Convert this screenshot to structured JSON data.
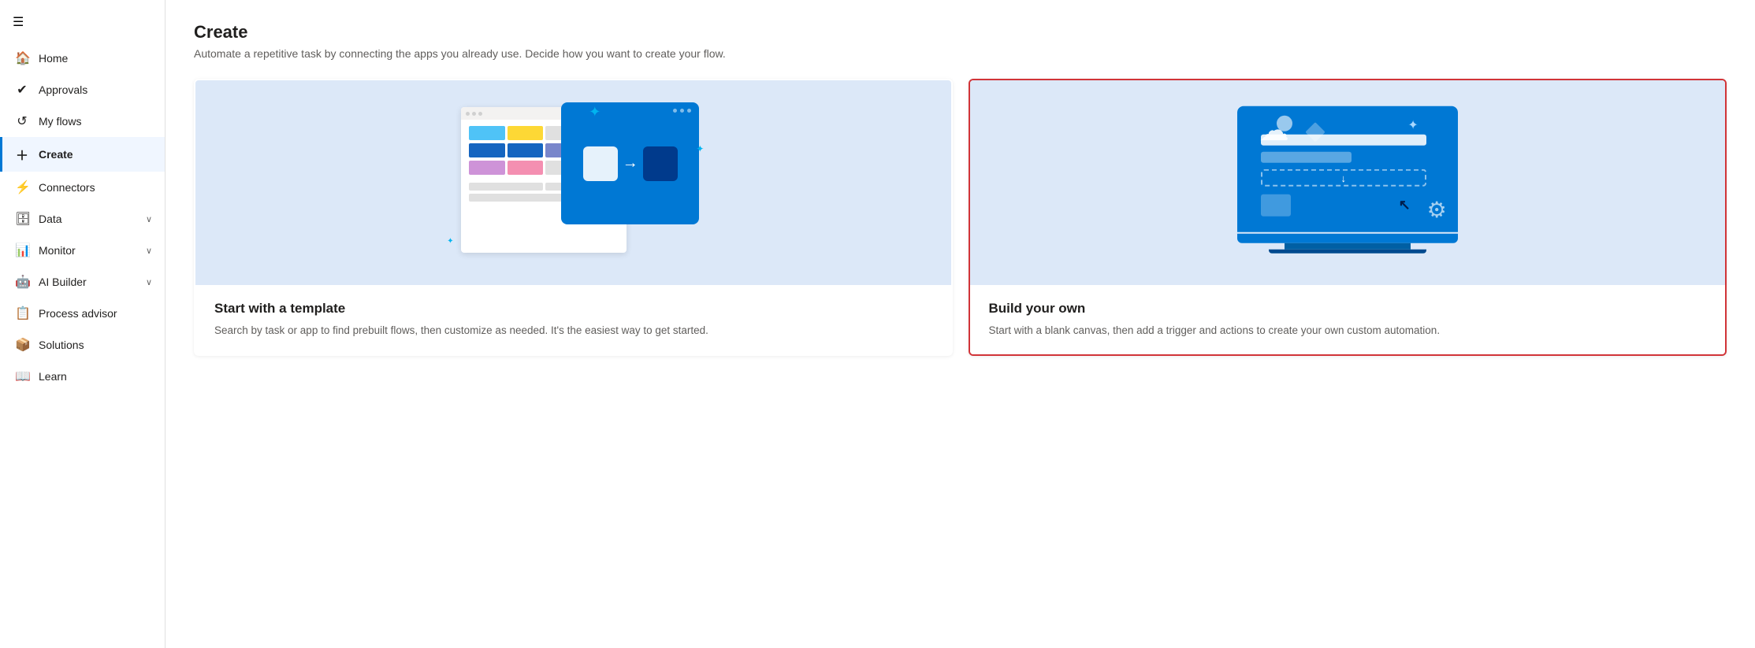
{
  "sidebar": {
    "hamburger_icon": "☰",
    "items": [
      {
        "id": "home",
        "label": "Home",
        "icon": "🏠",
        "hasChevron": false,
        "active": false
      },
      {
        "id": "approvals",
        "label": "Approvals",
        "icon": "✓",
        "hasChevron": false,
        "active": false
      },
      {
        "id": "my-flows",
        "label": "My flows",
        "icon": "⟳",
        "hasChevron": false,
        "active": false
      },
      {
        "id": "create",
        "label": "Create",
        "icon": "+",
        "hasChevron": false,
        "active": true
      },
      {
        "id": "connectors",
        "label": "Connectors",
        "icon": "⚙",
        "hasChevron": false,
        "active": false
      },
      {
        "id": "data",
        "label": "Data",
        "icon": "◫",
        "hasChevron": true,
        "active": false
      },
      {
        "id": "monitor",
        "label": "Monitor",
        "icon": "📊",
        "hasChevron": true,
        "active": false
      },
      {
        "id": "ai-builder",
        "label": "AI Builder",
        "icon": "🤖",
        "hasChevron": true,
        "active": false
      },
      {
        "id": "process-advisor",
        "label": "Process advisor",
        "icon": "📋",
        "hasChevron": false,
        "active": false
      },
      {
        "id": "solutions",
        "label": "Solutions",
        "icon": "📦",
        "hasChevron": false,
        "active": false
      },
      {
        "id": "learn",
        "label": "Learn",
        "icon": "📖",
        "hasChevron": false,
        "active": false
      }
    ]
  },
  "page": {
    "title": "Create",
    "subtitle": "Automate a repetitive task by connecting the apps you already use. Decide how you want to create your flow."
  },
  "cards": [
    {
      "id": "template",
      "title": "Start with a template",
      "description": "Search by task or app to find prebuilt flows, then customize as needed. It's the easiest way to get started.",
      "selected": false
    },
    {
      "id": "build",
      "title": "Build your own",
      "description": "Start with a blank canvas, then add a trigger and actions to create your own custom automation.",
      "selected": true
    }
  ]
}
